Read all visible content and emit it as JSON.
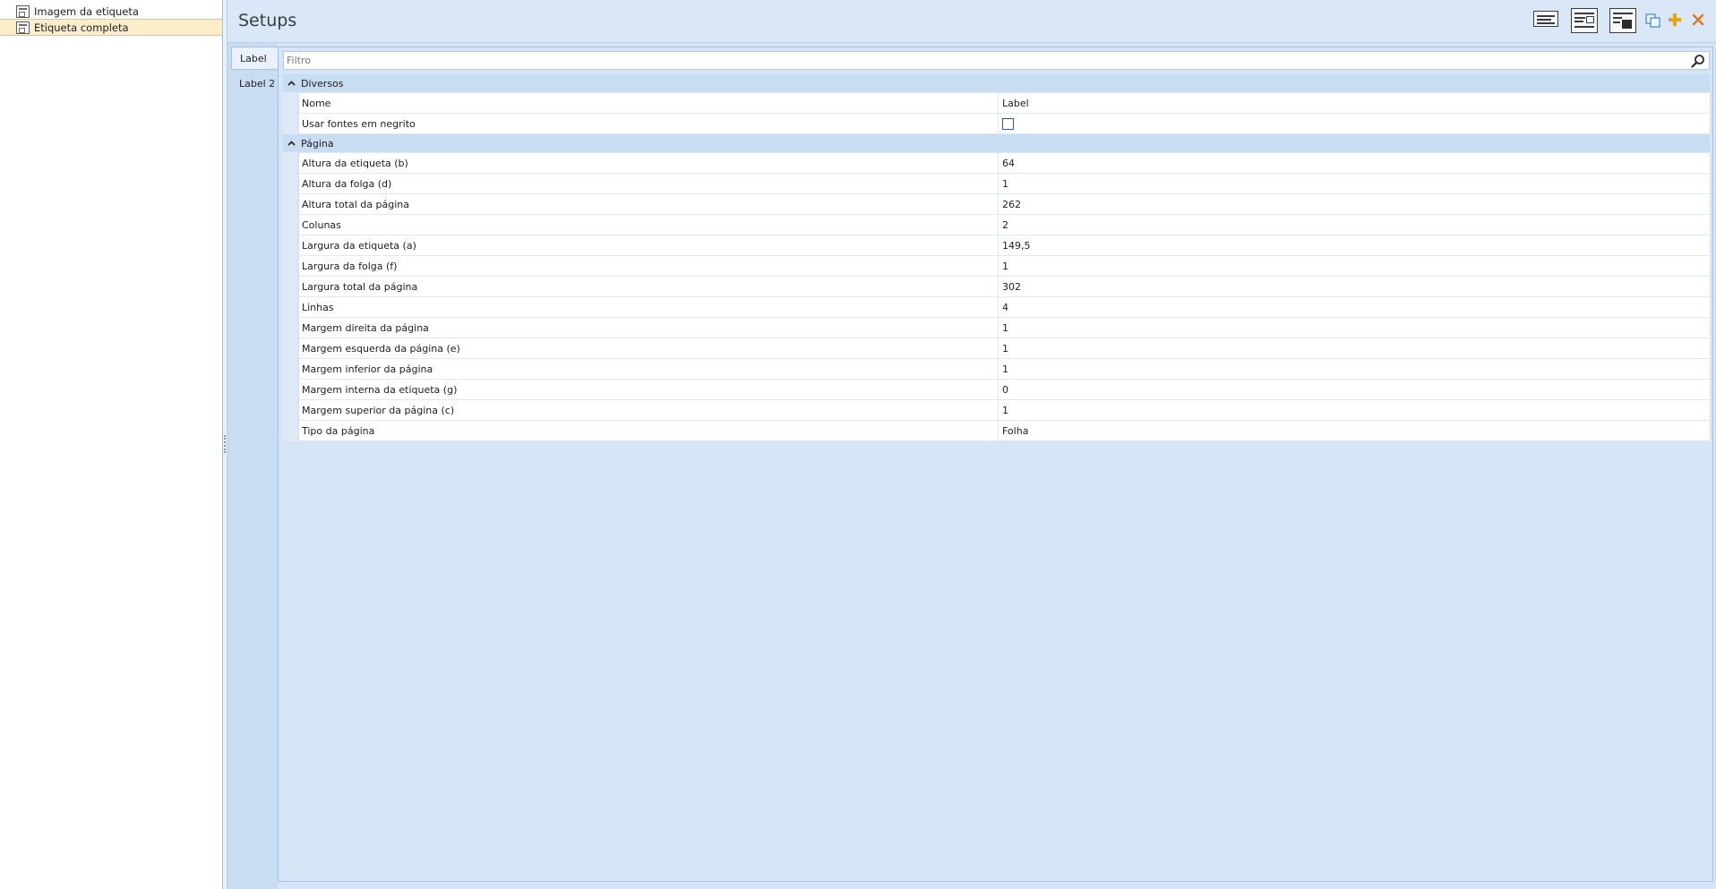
{
  "sidebar": {
    "items": [
      {
        "label": "Imagem da etiqueta",
        "icon": "label-image-icon"
      },
      {
        "label": "Etiqueta completa",
        "icon": "full-label-icon",
        "selected": true
      }
    ]
  },
  "header": {
    "title": "Setups",
    "toolbar": [
      "layout-text-icon",
      "layout-form-icon",
      "layout-image-icon",
      "copy-icon",
      "add-icon",
      "close-icon"
    ]
  },
  "tabs": [
    {
      "label": "Label",
      "active": true
    },
    {
      "label": "Label 2",
      "active": false
    }
  ],
  "filter": {
    "placeholder": "Filtro",
    "value": ""
  },
  "grid": {
    "categories": [
      {
        "label": "Diversos",
        "expanded": true,
        "properties": [
          {
            "name": "Nome",
            "value": "Label"
          },
          {
            "name": "Usar fontes em negrito",
            "value": "",
            "type": "checkbox",
            "checked": false
          }
        ]
      },
      {
        "label": "Página",
        "expanded": true,
        "properties": [
          {
            "name": "Altura da etiqueta (b)",
            "value": "64"
          },
          {
            "name": "Altura da folga (d)",
            "value": "1"
          },
          {
            "name": "Altura total da página",
            "value": "262"
          },
          {
            "name": "Colunas",
            "value": "2"
          },
          {
            "name": "Largura da etiqueta (a)",
            "value": "149,5"
          },
          {
            "name": "Largura da folga (f)",
            "value": "1"
          },
          {
            "name": "Largura total da página",
            "value": "302"
          },
          {
            "name": "Linhas",
            "value": "4"
          },
          {
            "name": "Margem direita da página",
            "value": "1"
          },
          {
            "name": "Margem esquerda da página (e)",
            "value": "1"
          },
          {
            "name": "Margem inferior da página",
            "value": "1"
          },
          {
            "name": "Margem interna da etiqueta (g)",
            "value": "0"
          },
          {
            "name": "Margem superior da página (c)",
            "value": "1"
          },
          {
            "name": "Tipo da página",
            "value": "Folha"
          }
        ]
      }
    ]
  },
  "colors": {
    "accent": "#c8dcf2",
    "selection": "#fdeecb",
    "add_icon": "#e8a317",
    "close_icon": "#e0761f",
    "copy_icon": "#3f88d8"
  }
}
